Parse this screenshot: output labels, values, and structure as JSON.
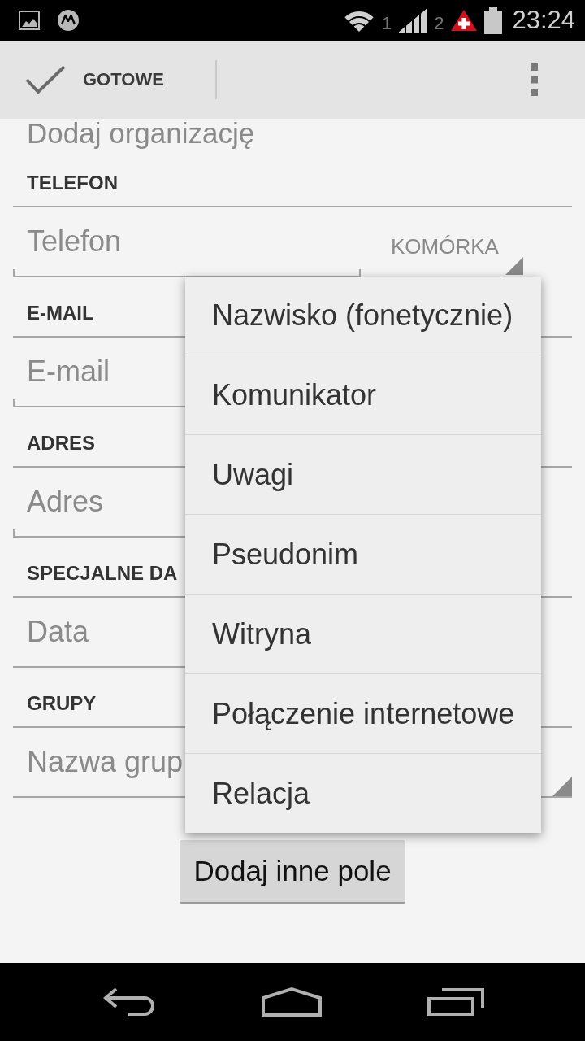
{
  "status_bar": {
    "sims": [
      {
        "label": "1",
        "kind": "signal"
      },
      {
        "label": "2",
        "kind": "alert"
      }
    ],
    "time": "23:24"
  },
  "action_bar": {
    "done_label": "GOTOWE"
  },
  "form": {
    "add_organization": "Dodaj organizację",
    "sections": [
      {
        "header": "TELEFON",
        "field": {
          "kind": "text",
          "placeholder": "Telefon",
          "type_label": "KOMÓRKA"
        }
      },
      {
        "header": "E-MAIL",
        "field": {
          "kind": "text",
          "placeholder": "E-mail"
        }
      },
      {
        "header": "ADRES",
        "field": {
          "kind": "text",
          "placeholder": "Adres"
        }
      },
      {
        "header": "SPECJALNE DA",
        "field": {
          "kind": "date",
          "placeholder": "Data"
        }
      },
      {
        "header": "GRUPY",
        "field": {
          "kind": "group",
          "placeholder": "Nazwa grup"
        }
      }
    ]
  },
  "add_field_button": "Dodaj inne pole",
  "popup_menu": {
    "items": [
      {
        "label": "Nazwisko (fonetycznie)"
      },
      {
        "label": "Komunikator"
      },
      {
        "label": "Uwagi"
      },
      {
        "label": "Pseudonim"
      },
      {
        "label": "Witryna"
      },
      {
        "label": "Połączenie internetowe"
      },
      {
        "label": "Relacja"
      }
    ]
  }
}
